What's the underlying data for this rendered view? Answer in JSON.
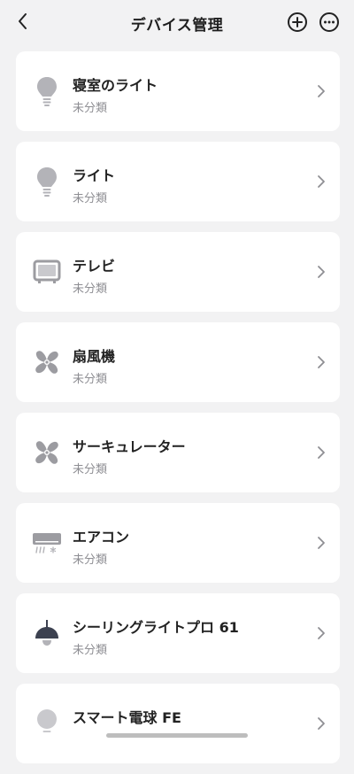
{
  "header": {
    "title": "デバイス管理",
    "back_icon": "chevron-left-icon",
    "add_icon": "plus-circle-icon",
    "more_icon": "more-circle-icon"
  },
  "devices": [
    {
      "name": "寝室のライト",
      "category": "未分類",
      "icon": "bulb-icon"
    },
    {
      "name": "ライト",
      "category": "未分類",
      "icon": "bulb-icon"
    },
    {
      "name": "テレビ",
      "category": "未分類",
      "icon": "tv-icon"
    },
    {
      "name": "扇風機",
      "category": "未分類",
      "icon": "fan-icon"
    },
    {
      "name": "サーキュレーター",
      "category": "未分類",
      "icon": "fan-icon"
    },
    {
      "name": "エアコン",
      "category": "未分類",
      "icon": "aircon-icon"
    },
    {
      "name": "シーリングライトプロ 61",
      "category": "未分類",
      "icon": "ceiling-light-icon"
    },
    {
      "name": "スマート電球 FE",
      "category": "",
      "icon": "smart-bulb-icon"
    }
  ],
  "colors": {
    "background": "#f2f2f3",
    "card": "#ffffff",
    "icon_gray": "#b3b3b8",
    "subtext": "#8e8e93"
  }
}
